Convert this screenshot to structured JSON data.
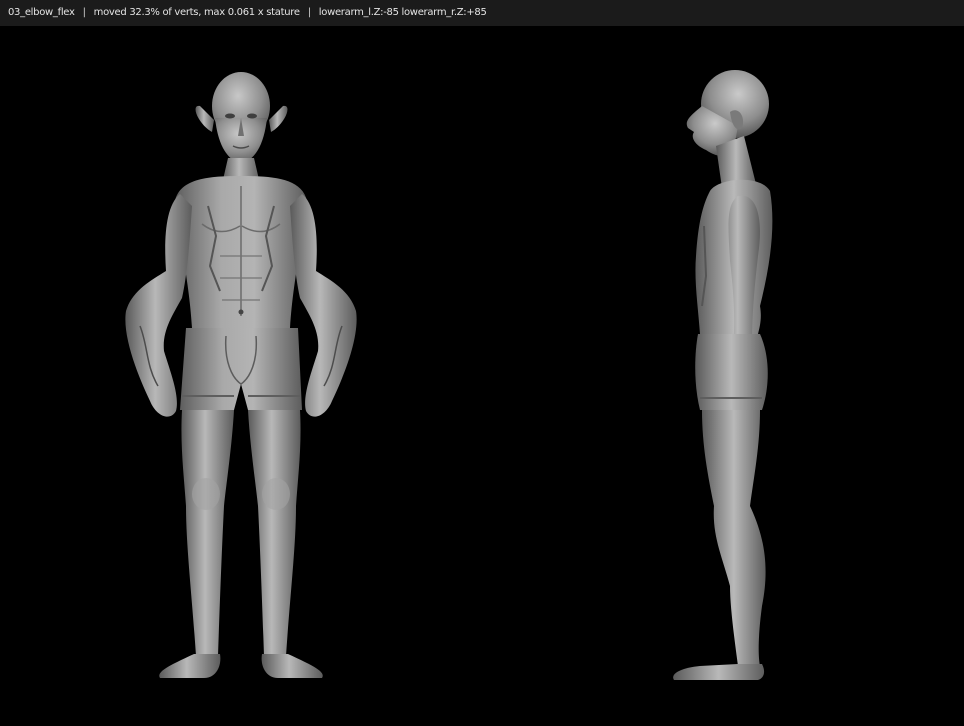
{
  "header": {
    "case_name": "03_elbow_flex",
    "separator": "|",
    "stats": "moved 32.3% of verts, max 0.061 x stature",
    "rotations": "lowerarm_l.Z:-85 lowerarm_r.Z:+85"
  },
  "colors": {
    "background": "#000000",
    "header_bar": "#1b1b1b",
    "header_text": "#e4e4e4",
    "mesh_base": "#8e8e8e",
    "mesh_highlight": "#c9c9c9",
    "mesh_shadow": "#4a4a4a"
  }
}
